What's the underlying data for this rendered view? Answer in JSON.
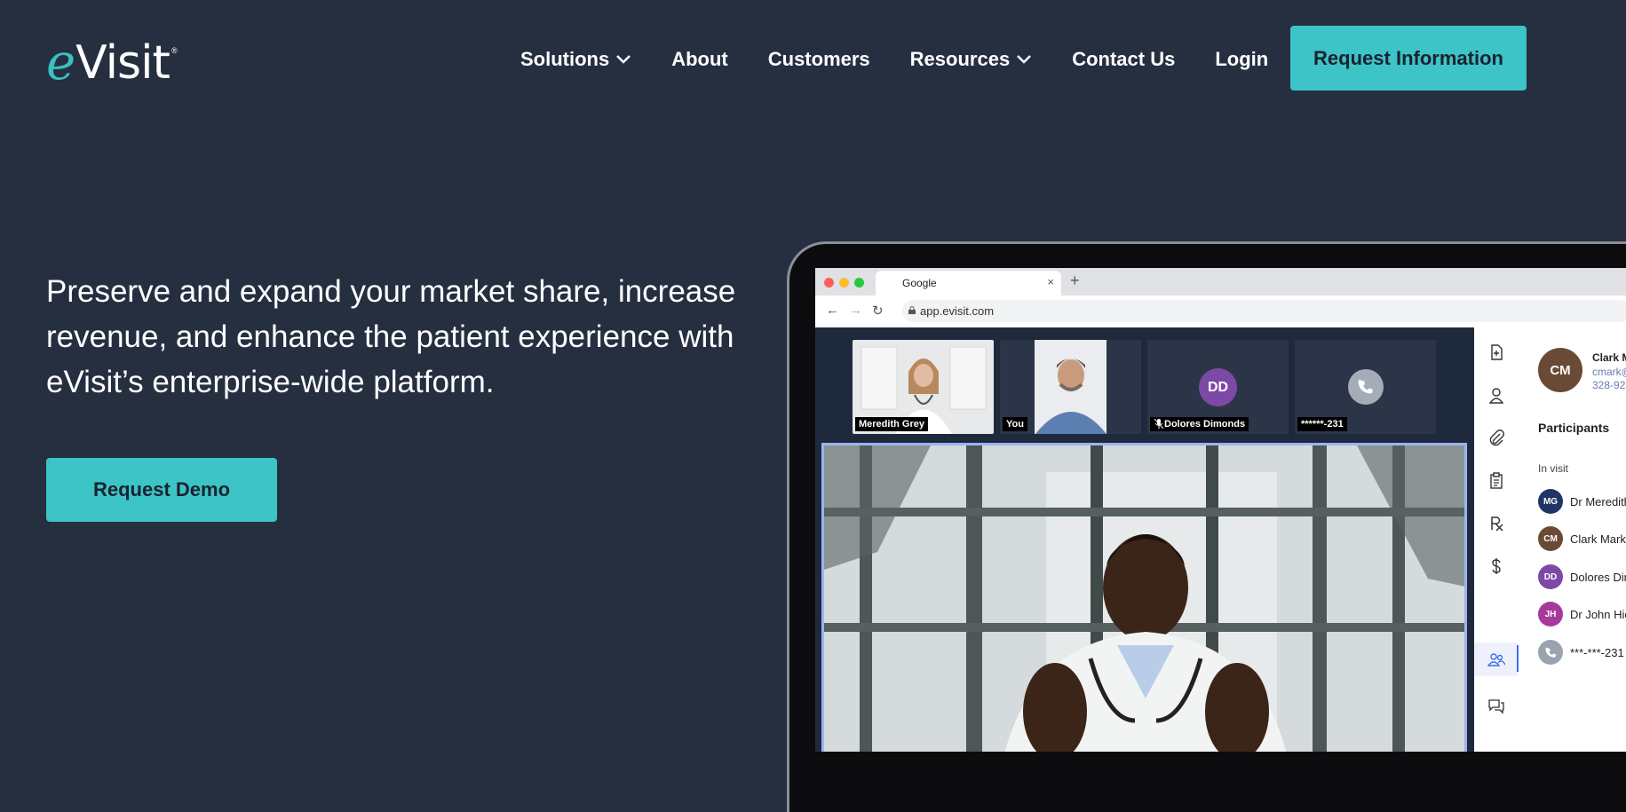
{
  "colors": {
    "background": "#252f40",
    "accent": "#3cc4c6",
    "logo_e": "#3cbfc1"
  },
  "logo": {
    "e": "e",
    "rest": "Visit",
    "reg": "®"
  },
  "nav": {
    "items": [
      {
        "label": "Solutions",
        "dropdown": true
      },
      {
        "label": "About",
        "dropdown": false
      },
      {
        "label": "Customers",
        "dropdown": false
      },
      {
        "label": "Resources",
        "dropdown": true
      },
      {
        "label": "Contact Us",
        "dropdown": false
      },
      {
        "label": "Login",
        "dropdown": false
      }
    ],
    "cta_label": "Request Information"
  },
  "hero": {
    "headline": "Preserve and expand your market share, increase revenue, and enhance the patient experience with eVisit’s enterprise-wide platform.",
    "cta_label": "Request Demo"
  },
  "mockup": {
    "browser": {
      "tab_title": "Google",
      "tab_close": "×",
      "tab_plus": "+",
      "url": "app.evisit.com"
    },
    "thumbnails": [
      {
        "label": "Meredith Grey",
        "avatar": ""
      },
      {
        "label": "You",
        "avatar": ""
      },
      {
        "label": "Dolores Dimonds",
        "avatar": "DD",
        "muted": true
      },
      {
        "label": "******-231",
        "avatar": "phone-icon"
      }
    ],
    "panel": {
      "contact_initials": "CM",
      "contact_name": "Clark M",
      "contact_email": "cmark@",
      "contact_phone": "328-92",
      "heading": "Participants",
      "section": "In visit",
      "participants": [
        {
          "initials": "MG",
          "name": "Dr Meredith",
          "color": "#1f3566"
        },
        {
          "initials": "CM",
          "name": "Clark Mark",
          "color": "#6b4a35"
        },
        {
          "initials": "DD",
          "name": "Dolores Dim",
          "color": "#7c4aa6"
        },
        {
          "initials": "JH",
          "name": "Dr John Hic",
          "color": "#a63a9c"
        },
        {
          "initials": "",
          "name": "***-***-231",
          "color": "#9aa3af",
          "icon": "phone-icon"
        }
      ]
    },
    "rail_icons": [
      "document-add-icon",
      "person-icon",
      "paperclip-icon",
      "clipboard-icon",
      "rx-icon",
      "dollar-icon",
      "participants-icon",
      "chat-icon"
    ]
  }
}
